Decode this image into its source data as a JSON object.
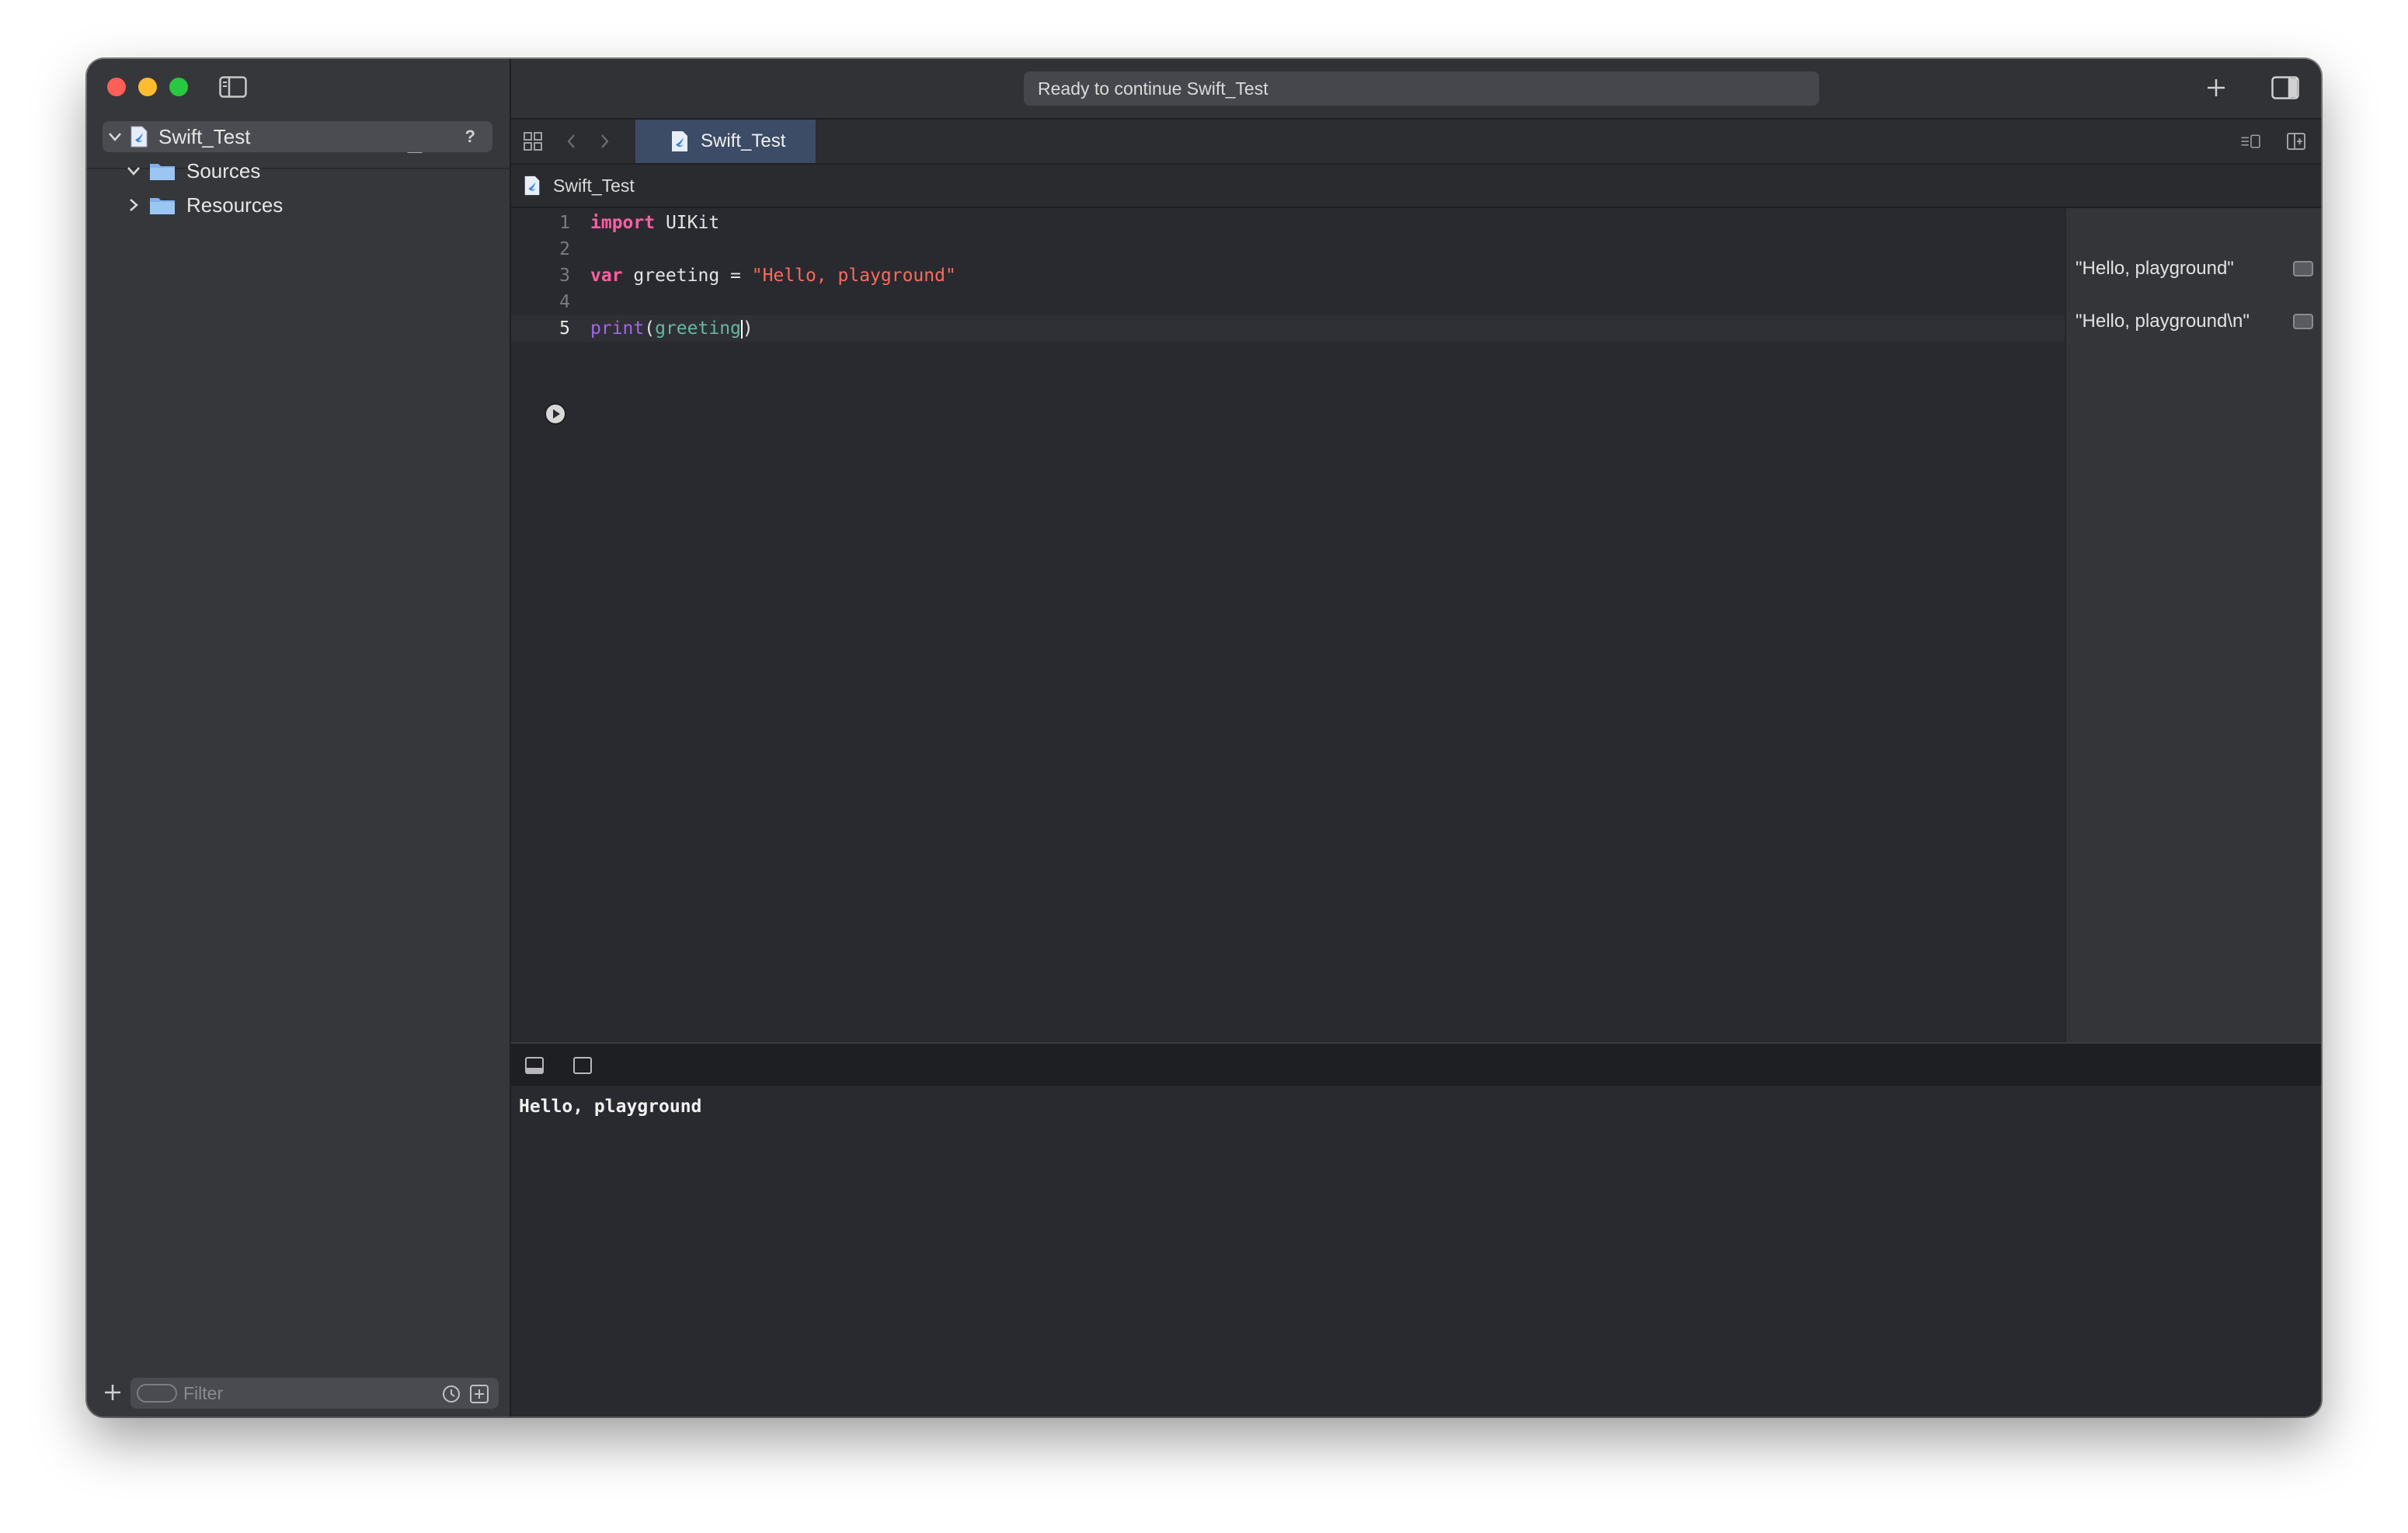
{
  "window": {
    "status": "Ready to continue Swift_Test"
  },
  "sidebar": {
    "project": {
      "name": "Swift_Test",
      "badge": "?"
    },
    "items": [
      {
        "label": "Sources",
        "expanded": true
      },
      {
        "label": "Resources",
        "expanded": false
      }
    ],
    "filter_placeholder": "Filter",
    "nav_icons": [
      "folder-icon",
      "source-control-icon",
      "symbol-hierarchy-icon",
      "find-icon",
      "issue-warning-icon",
      "report-icon"
    ]
  },
  "editor": {
    "tab_label": "Swift_Test",
    "breadcrumb": "Swift_Test",
    "lines": [
      {
        "num": "1",
        "kw": "import",
        "rest": " UIKit"
      },
      {
        "num": "2"
      },
      {
        "num": "3",
        "kw": "var",
        "rest": " greeting = ",
        "str": "\"Hello, playground\""
      },
      {
        "num": "4"
      },
      {
        "num": "5",
        "fn": "print",
        "open": "(",
        "var": "greeting",
        "close": ")"
      }
    ]
  },
  "results": [
    {
      "line": 3,
      "value": "\"Hello, playground\""
    },
    {
      "line": 5,
      "value": "\"Hello, playground\\n\""
    }
  ],
  "console": {
    "output": "Hello, playground"
  },
  "colors": {
    "keyword": "#fc5fa3",
    "string": "#fc6a5d",
    "function": "#a167e6",
    "variable": "#67b7a4",
    "tab_selected": "#3c4b66",
    "folder_accent": "#2f7ee6"
  }
}
